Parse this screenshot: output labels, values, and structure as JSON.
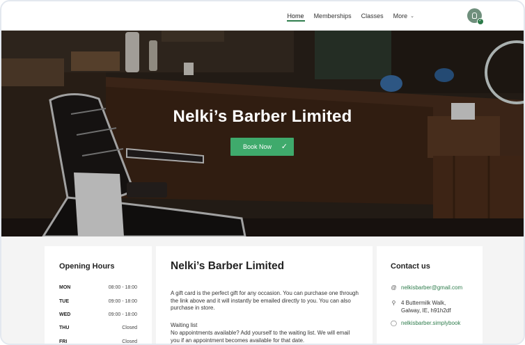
{
  "nav": {
    "items": [
      {
        "label": "Home",
        "active": true
      },
      {
        "label": "Memberships",
        "active": false
      },
      {
        "label": "Classes",
        "active": false
      }
    ],
    "more_label": "More"
  },
  "hero": {
    "title": "Nelki’s Barber Limited",
    "book_button": "Book Now"
  },
  "opening_hours": {
    "title": "Opening Hours",
    "rows": [
      {
        "day": "MON",
        "time": "08:00 - 18:00"
      },
      {
        "day": "TUE",
        "time": "09:00 - 18:00"
      },
      {
        "day": "WED",
        "time": "09:00 - 18:00"
      },
      {
        "day": "THU",
        "time": "Closed"
      },
      {
        "day": "FRI",
        "time": "Closed"
      }
    ]
  },
  "about": {
    "title": "Nelki’s Barber Limited",
    "gift_card_text": "A gift card is the perfect gift for any occasion. You can purchase one through the link above and it will instantly be emailed directly to you. You can also purchase in store.",
    "waiting_list_heading": "Waiting list",
    "waiting_list_text": "No appointments available? Add yourself to the waiting list. We will email you if an appointment becomes available for that date."
  },
  "contact": {
    "title": "Contact us",
    "email": "nelkisbarber@gmail.com",
    "address_line1": "4 Buttermilk Walk,",
    "address_line2": "Galway, IE, h91h2df",
    "website": "nelkisbarber.simplybook"
  },
  "colors": {
    "accent": "#3faa6c",
    "link": "#2f7d4d"
  }
}
